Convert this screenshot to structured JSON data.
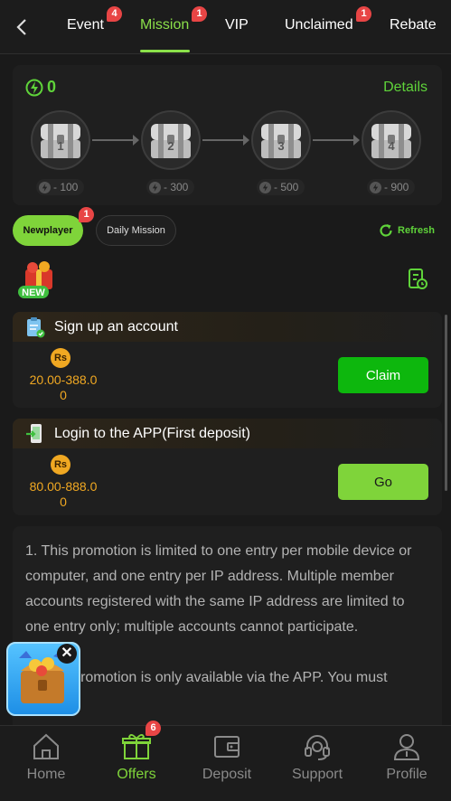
{
  "nav": {
    "tabs": [
      {
        "label": "Event",
        "badge": "4"
      },
      {
        "label": "Mission",
        "badge": "1"
      },
      {
        "label": "VIP",
        "badge": ""
      },
      {
        "label": "Unclaimed",
        "badge": "1"
      },
      {
        "label": "Rebate",
        "badge": ""
      }
    ],
    "active_tab": "Mission"
  },
  "progress": {
    "points": "0",
    "details_label": "Details",
    "chests": [
      {
        "number": "1",
        "cost": "- 100"
      },
      {
        "number": "2",
        "cost": "- 300"
      },
      {
        "number": "3",
        "cost": "- 500"
      },
      {
        "number": "4",
        "cost": "- 900"
      }
    ]
  },
  "mission_tabs": {
    "newplayer": "Newplayer",
    "newplayer_badge": "1",
    "daily": "Daily Mission",
    "refresh": "Refresh"
  },
  "new_tag": "NEW",
  "missions": [
    {
      "title": "Sign up an account",
      "currency": "Rs",
      "reward_line1": "20.00-388.0",
      "reward_line2": "0",
      "action": "Claim"
    },
    {
      "title": "Login to the APP(First deposit)",
      "currency": "Rs",
      "reward_line1": "80.00-888.0",
      "reward_line2": "0",
      "action": "Go"
    }
  ],
  "rules": {
    "p1": "1. This promotion is limited to one entry per mobile device or computer, and one entry per IP address. Multiple member accounts registered with the same IP address are limited to one entry only; multiple accounts cannot participate.",
    "p2": "2. This promotion is only available via the APP. You must"
  },
  "float": {
    "close": "✕"
  },
  "bottom_nav": [
    {
      "label": "Home",
      "icon": "home-icon"
    },
    {
      "label": "Offers",
      "icon": "gift-icon",
      "badge": "6"
    },
    {
      "label": "Deposit",
      "icon": "wallet-icon"
    },
    {
      "label": "Support",
      "icon": "headset-icon"
    },
    {
      "label": "Profile",
      "icon": "user-icon"
    }
  ],
  "colors": {
    "accent": "#7fd43a",
    "claim": "#0db70d",
    "badge": "#e84545",
    "reward": "#f0a822"
  }
}
